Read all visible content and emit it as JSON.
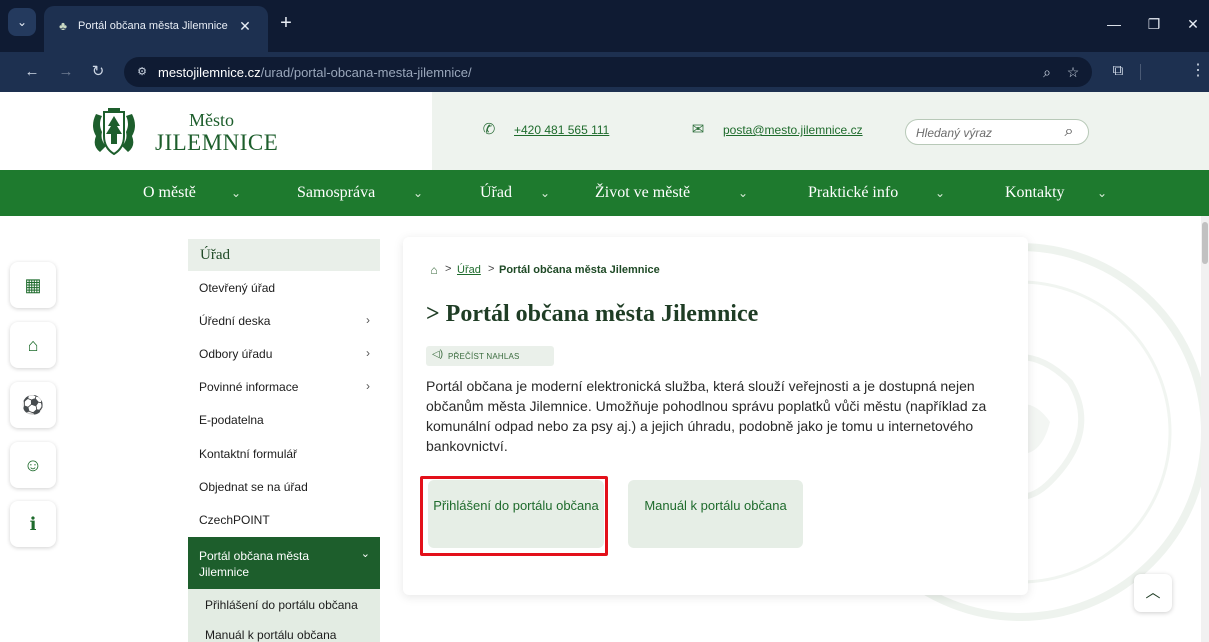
{
  "browser": {
    "tab_title": "Portál občana města Jilemnice",
    "tab_close": "✕",
    "new_tab": "+",
    "url_host": "mestojilemnice.cz",
    "url_path": "/urad/portal-obcana-mesta-jilemnice/",
    "icons": [
      "tab-list-icon",
      "favicon-icon",
      "close-icon",
      "new-tab-icon",
      "minimize-icon",
      "restore-icon",
      "window-close-icon",
      "back-icon",
      "forward-icon",
      "reload-icon",
      "site-info-icon",
      "zoom-icon",
      "bookmark-star-icon",
      "extensions-icon",
      "menu-icon"
    ]
  },
  "header": {
    "logo_small": "Město",
    "logo_big": "JILEMNICE",
    "phone": "+420 481 565 111",
    "email": "posta@mesto.jilemnice.cz",
    "search_placeholder": "Hledaný výraz"
  },
  "nav": [
    {
      "label": "O městě"
    },
    {
      "label": "Samospráva"
    },
    {
      "label": "Úřad"
    },
    {
      "label": "Život ve městě"
    },
    {
      "label": "Praktické info"
    },
    {
      "label": "Kontakty"
    }
  ],
  "side_icons": [
    "office-building-icon",
    "bank-icon",
    "soccer-ball-icon",
    "people-icon",
    "info-icon"
  ],
  "sidebar": {
    "heading": "Úřad",
    "items": [
      {
        "label": "Otevřený úřad",
        "has_children": false
      },
      {
        "label": "Úřední deska",
        "has_children": true
      },
      {
        "label": "Odbory úřadu",
        "has_children": true
      },
      {
        "label": "Povinné informace",
        "has_children": true
      },
      {
        "label": "E-podatelna",
        "has_children": false
      },
      {
        "label": "Kontaktní formulář",
        "has_children": false
      },
      {
        "label": "Objednat se na úřad",
        "has_children": false
      },
      {
        "label": "CzechPOINT",
        "has_children": false
      }
    ],
    "active": "Portál občana města Jilemnice",
    "sub_items": [
      {
        "label": "Přihlášení do portálu občana"
      },
      {
        "label": "Manuál k portálu občana"
      }
    ]
  },
  "content": {
    "breadcrumb_link": "Úřad",
    "breadcrumb_current": "Portál občana města Jilemnice",
    "breadcrumb_sep": ">",
    "title": "> Portál občana města Jilemnice",
    "read_aloud": "PŘEČÍST NAHLAS",
    "description": "Portál občana je moderní elektronická služba, která slouží veřejnosti a je dostupná nejen občanům města Jilemnice. Umožňuje pohodlnou správu poplatků vůči městu (například za komunální odpad nebo za psy aj.) a jejich úhradu, podobně jako je tomu u internetového bankovnictví.",
    "button_login": "Přihlášení do portálu občana",
    "button_manual": "Manuál k portálu občana"
  },
  "seal_text": "MĚSTO JILEMNICE",
  "colors": {
    "brand_green": "#1e7a2e",
    "dark_green": "#1d5e2c",
    "highlight_red": "#e3101a"
  }
}
